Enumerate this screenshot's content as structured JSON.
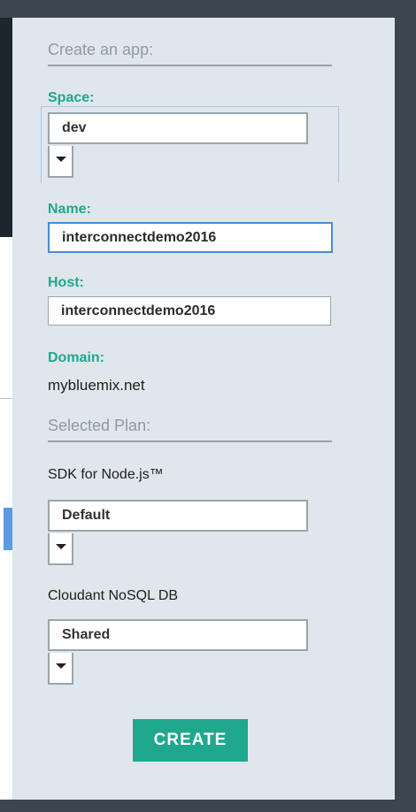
{
  "sections": {
    "create_app": "Create an app:",
    "selected_plan": "Selected Plan:"
  },
  "space": {
    "label": "Space:",
    "value": "dev"
  },
  "name": {
    "label": "Name:",
    "value": "interconnectdemo2016"
  },
  "host": {
    "label": "Host:",
    "value": "interconnectdemo2016"
  },
  "domain": {
    "label": "Domain:",
    "value": "mybluemix.net"
  },
  "plans": [
    {
      "service": "SDK for Node.js™",
      "value": "Default"
    },
    {
      "service": "Cloudant NoSQL DB",
      "value": "Shared"
    }
  ],
  "actions": {
    "create_label": "CREATE"
  },
  "colors": {
    "accent": "#1fa88e",
    "focus": "#4a8bd6",
    "panel": "#dfe6ec"
  },
  "icons": {
    "dropdown": "chevron-down-icon"
  }
}
